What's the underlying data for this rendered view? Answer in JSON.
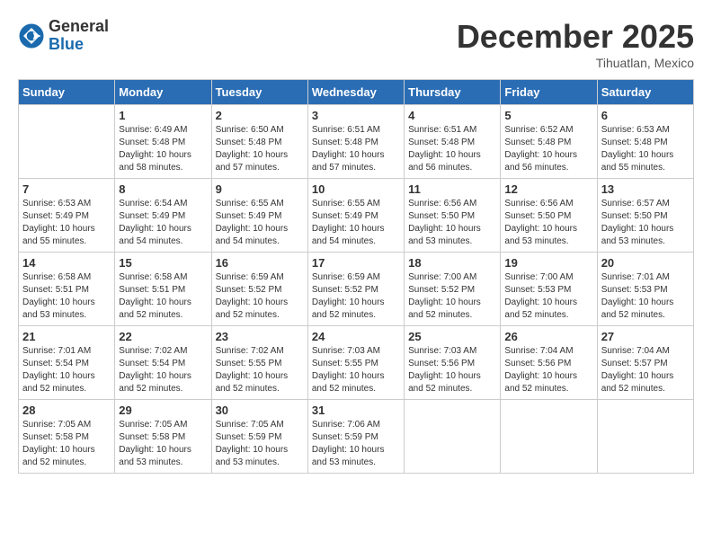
{
  "header": {
    "logo_general": "General",
    "logo_blue": "Blue",
    "month_title": "December 2025",
    "location": "Tihuatlan, Mexico"
  },
  "weekdays": [
    "Sunday",
    "Monday",
    "Tuesday",
    "Wednesday",
    "Thursday",
    "Friday",
    "Saturday"
  ],
  "weeks": [
    [
      {
        "day": "",
        "info": ""
      },
      {
        "day": "1",
        "info": "Sunrise: 6:49 AM\nSunset: 5:48 PM\nDaylight: 10 hours\nand 58 minutes."
      },
      {
        "day": "2",
        "info": "Sunrise: 6:50 AM\nSunset: 5:48 PM\nDaylight: 10 hours\nand 57 minutes."
      },
      {
        "day": "3",
        "info": "Sunrise: 6:51 AM\nSunset: 5:48 PM\nDaylight: 10 hours\nand 57 minutes."
      },
      {
        "day": "4",
        "info": "Sunrise: 6:51 AM\nSunset: 5:48 PM\nDaylight: 10 hours\nand 56 minutes."
      },
      {
        "day": "5",
        "info": "Sunrise: 6:52 AM\nSunset: 5:48 PM\nDaylight: 10 hours\nand 56 minutes."
      },
      {
        "day": "6",
        "info": "Sunrise: 6:53 AM\nSunset: 5:48 PM\nDaylight: 10 hours\nand 55 minutes."
      }
    ],
    [
      {
        "day": "7",
        "info": "Sunrise: 6:53 AM\nSunset: 5:49 PM\nDaylight: 10 hours\nand 55 minutes."
      },
      {
        "day": "8",
        "info": "Sunrise: 6:54 AM\nSunset: 5:49 PM\nDaylight: 10 hours\nand 54 minutes."
      },
      {
        "day": "9",
        "info": "Sunrise: 6:55 AM\nSunset: 5:49 PM\nDaylight: 10 hours\nand 54 minutes."
      },
      {
        "day": "10",
        "info": "Sunrise: 6:55 AM\nSunset: 5:49 PM\nDaylight: 10 hours\nand 54 minutes."
      },
      {
        "day": "11",
        "info": "Sunrise: 6:56 AM\nSunset: 5:50 PM\nDaylight: 10 hours\nand 53 minutes."
      },
      {
        "day": "12",
        "info": "Sunrise: 6:56 AM\nSunset: 5:50 PM\nDaylight: 10 hours\nand 53 minutes."
      },
      {
        "day": "13",
        "info": "Sunrise: 6:57 AM\nSunset: 5:50 PM\nDaylight: 10 hours\nand 53 minutes."
      }
    ],
    [
      {
        "day": "14",
        "info": "Sunrise: 6:58 AM\nSunset: 5:51 PM\nDaylight: 10 hours\nand 53 minutes."
      },
      {
        "day": "15",
        "info": "Sunrise: 6:58 AM\nSunset: 5:51 PM\nDaylight: 10 hours\nand 52 minutes."
      },
      {
        "day": "16",
        "info": "Sunrise: 6:59 AM\nSunset: 5:52 PM\nDaylight: 10 hours\nand 52 minutes."
      },
      {
        "day": "17",
        "info": "Sunrise: 6:59 AM\nSunset: 5:52 PM\nDaylight: 10 hours\nand 52 minutes."
      },
      {
        "day": "18",
        "info": "Sunrise: 7:00 AM\nSunset: 5:52 PM\nDaylight: 10 hours\nand 52 minutes."
      },
      {
        "day": "19",
        "info": "Sunrise: 7:00 AM\nSunset: 5:53 PM\nDaylight: 10 hours\nand 52 minutes."
      },
      {
        "day": "20",
        "info": "Sunrise: 7:01 AM\nSunset: 5:53 PM\nDaylight: 10 hours\nand 52 minutes."
      }
    ],
    [
      {
        "day": "21",
        "info": "Sunrise: 7:01 AM\nSunset: 5:54 PM\nDaylight: 10 hours\nand 52 minutes."
      },
      {
        "day": "22",
        "info": "Sunrise: 7:02 AM\nSunset: 5:54 PM\nDaylight: 10 hours\nand 52 minutes."
      },
      {
        "day": "23",
        "info": "Sunrise: 7:02 AM\nSunset: 5:55 PM\nDaylight: 10 hours\nand 52 minutes."
      },
      {
        "day": "24",
        "info": "Sunrise: 7:03 AM\nSunset: 5:55 PM\nDaylight: 10 hours\nand 52 minutes."
      },
      {
        "day": "25",
        "info": "Sunrise: 7:03 AM\nSunset: 5:56 PM\nDaylight: 10 hours\nand 52 minutes."
      },
      {
        "day": "26",
        "info": "Sunrise: 7:04 AM\nSunset: 5:56 PM\nDaylight: 10 hours\nand 52 minutes."
      },
      {
        "day": "27",
        "info": "Sunrise: 7:04 AM\nSunset: 5:57 PM\nDaylight: 10 hours\nand 52 minutes."
      }
    ],
    [
      {
        "day": "28",
        "info": "Sunrise: 7:05 AM\nSunset: 5:58 PM\nDaylight: 10 hours\nand 52 minutes."
      },
      {
        "day": "29",
        "info": "Sunrise: 7:05 AM\nSunset: 5:58 PM\nDaylight: 10 hours\nand 53 minutes."
      },
      {
        "day": "30",
        "info": "Sunrise: 7:05 AM\nSunset: 5:59 PM\nDaylight: 10 hours\nand 53 minutes."
      },
      {
        "day": "31",
        "info": "Sunrise: 7:06 AM\nSunset: 5:59 PM\nDaylight: 10 hours\nand 53 minutes."
      },
      {
        "day": "",
        "info": ""
      },
      {
        "day": "",
        "info": ""
      },
      {
        "day": "",
        "info": ""
      }
    ]
  ]
}
